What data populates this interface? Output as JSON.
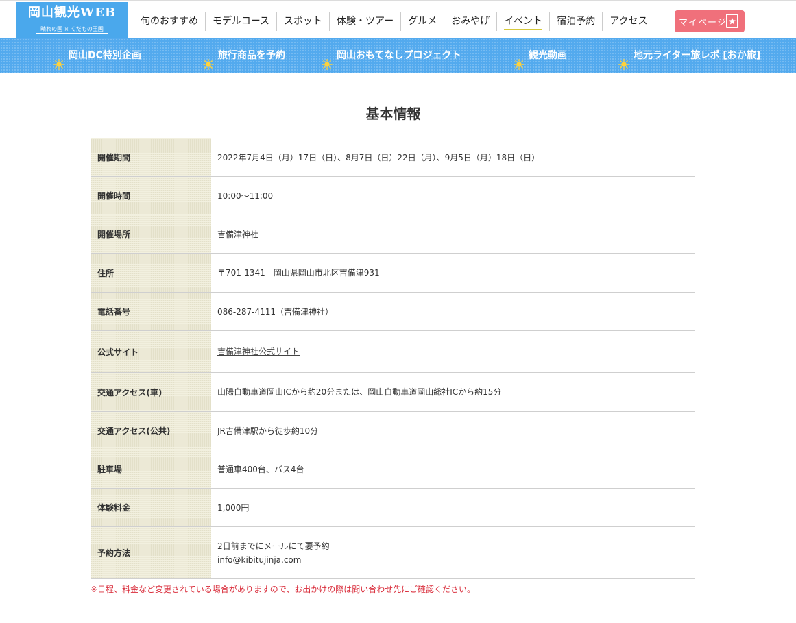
{
  "header": {
    "logo_title": "岡山観光WEB",
    "logo_tagline": "晴れの国 × くだもの王国",
    "nav": [
      {
        "label": "旬のおすすめ",
        "active": false
      },
      {
        "label": "モデルコース",
        "active": false
      },
      {
        "label": "スポット",
        "active": false
      },
      {
        "label": "体験・ツアー",
        "active": false
      },
      {
        "label": "グルメ",
        "active": false
      },
      {
        "label": "おみやげ",
        "active": false
      },
      {
        "label": "イベント",
        "active": true
      },
      {
        "label": "宿泊予約",
        "active": false
      },
      {
        "label": "アクセス",
        "active": false
      }
    ],
    "mypage_label": "マイページ",
    "mypage_icon": "bookmark-star-icon"
  },
  "subnav": {
    "items": [
      {
        "label": "岡山DC特別企画",
        "icon": "sun-icon"
      },
      {
        "label": "旅行商品を予約",
        "icon": "sun-icon"
      },
      {
        "label": "岡山おもてなしプロジェクト",
        "icon": "sun-icon"
      },
      {
        "label": "観光動画",
        "icon": "sun-icon"
      },
      {
        "label": "地元ライター旅レポ [おか旅]",
        "icon": "sun-icon"
      }
    ]
  },
  "main": {
    "title": "基本情報",
    "rows": [
      {
        "label": "開催期間",
        "value": "2022年7月4日（月）17日（日）、8月7日（日）22日（月）、9月5日（月）18日（日）"
      },
      {
        "label": "開催時間",
        "value": "10:00〜11:00"
      },
      {
        "label": "開催場所",
        "value": "吉備津神社"
      },
      {
        "label": "住所",
        "value": "〒701-1341　岡山県岡山市北区吉備津931"
      },
      {
        "label": "電話番号",
        "value": "086-287-4111（吉備津神社）"
      },
      {
        "label": "公式サイト",
        "value": "吉備津神社公式サイト"
      },
      {
        "label": "交通アクセス(車)",
        "value": "山陽自動車道岡山ICから約20分または、岡山自動車道岡山総社ICから約15分"
      },
      {
        "label": "交通アクセス(公共)",
        "value": "JR吉備津駅から徒歩約10分"
      },
      {
        "label": "駐車場",
        "value": "普通車400台、バス4台"
      },
      {
        "label": "体験料金",
        "value": "1,000円"
      },
      {
        "label": "予約方法",
        "value": "2日前までにメールにて要予約",
        "value2": "info@kibitujinja.com"
      }
    ],
    "note": "※日程、料金など変更されている場合がありますので、お出かけの際は問い合わせ先にご確認ください。"
  },
  "colors": {
    "brand_blue": "#4aa8ec",
    "subnav_blue": "#53aaee",
    "mypage_pink": "#f0707b",
    "label_beige": "#f2f0df",
    "note_red": "#d92c3a",
    "sun_yellow": "#ffd23a"
  }
}
